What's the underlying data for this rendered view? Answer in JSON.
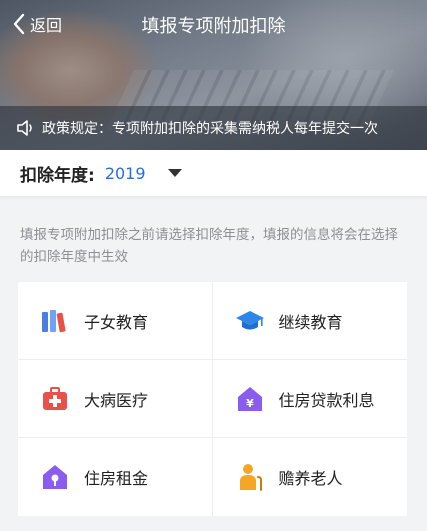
{
  "header": {
    "back_label": "返回",
    "title": "填报专项附加扣除"
  },
  "notice": {
    "icon": "speaker-icon",
    "text": "政策规定：专项附加扣除的采集需纳税人每年提交一次"
  },
  "year_selector": {
    "label": "扣除年度:",
    "value": "2019",
    "icon": "caret-down-icon"
  },
  "hint": "填报专项附加扣除之前请选择扣除年度，填报的信息将会在选择的扣除年度中生效",
  "items": [
    {
      "label": "子女教育",
      "icon": "books-icon",
      "color": "#4a7fe0"
    },
    {
      "label": "继续教育",
      "icon": "graduation-cap-icon",
      "color": "#2e86e8"
    },
    {
      "label": "大病医疗",
      "icon": "medical-kit-icon",
      "color": "#e8504a"
    },
    {
      "label": "住房贷款利息",
      "icon": "house-yen-icon",
      "color": "#8a5cf0"
    },
    {
      "label": "住房租金",
      "icon": "house-key-icon",
      "color": "#8a5cf0"
    },
    {
      "label": "赡养老人",
      "icon": "elderly-person-icon",
      "color": "#f5a623"
    }
  ]
}
